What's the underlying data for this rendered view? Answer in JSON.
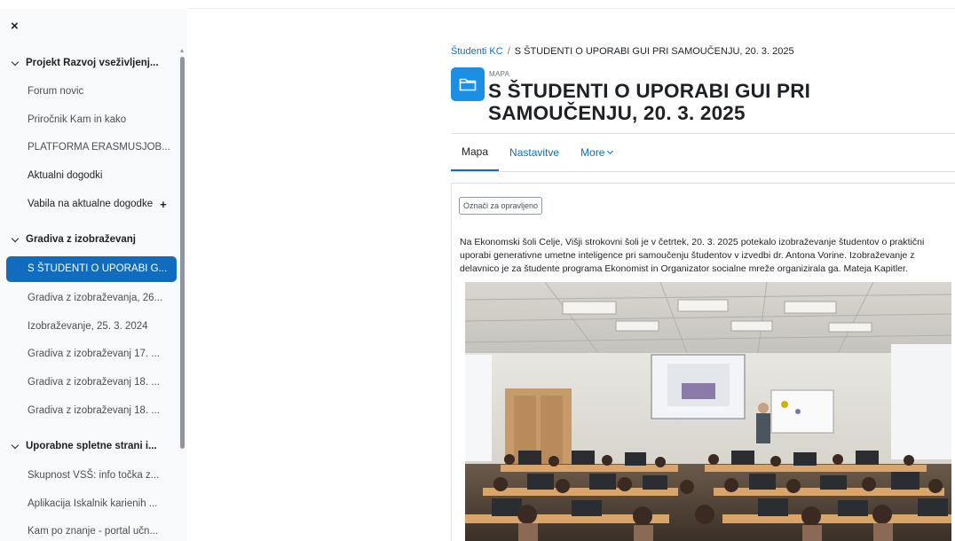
{
  "drawer": {
    "close_label": "×",
    "sections": [
      {
        "title": "Projekt Razvoj vseživljenj...",
        "items": [
          {
            "label": "Forum novic",
            "muted": true
          },
          {
            "label": "Priročnik Kam in kako",
            "muted": true
          },
          {
            "label": "PLATFORMA ERASMUSJOB...",
            "muted": true
          },
          {
            "label": "Aktualni dogodki",
            "muted": false
          },
          {
            "label": "Vabila na aktualne dogodke",
            "muted": false,
            "plus": "+"
          }
        ]
      },
      {
        "title": "Gradiva z izobraževanj",
        "items": [
          {
            "label": "S ŠTUDENTI O UPORABI G...",
            "active": true
          },
          {
            "label": "Gradiva z izobraževanja, 26...",
            "muted": true
          },
          {
            "label": "Izobraževanje, 25. 3. 2024",
            "muted": true
          },
          {
            "label": "Gradiva z izobraževanj 17. ...",
            "muted": true
          },
          {
            "label": "Gradiva z izobraževanj 18. ...",
            "muted": true
          },
          {
            "label": "Gradiva z izobraževanj 18. ...",
            "muted": true
          }
        ]
      },
      {
        "title": "Uporabne spletne strani i...",
        "items": [
          {
            "label": "Skupnost VSŠ: info točka z...",
            "muted": true
          },
          {
            "label": "Aplikacija Iskalnik karienih ...",
            "muted": true
          },
          {
            "label": "Kam po znanje - portal učn...",
            "muted": true
          }
        ]
      }
    ]
  },
  "breadcrumb": {
    "link": "Študenti KC",
    "separator": "/",
    "current": "S ŠTUDENTI O UPORABI GUI PRI SAMOUČENJU, 20. 3. 2025"
  },
  "header": {
    "module_type": "MAPA",
    "title": "S ŠTUDENTI O UPORABI GUI PRI SAMOUČENJU, 20. 3. 2025",
    "icon": "folder-icon"
  },
  "tabs": [
    {
      "label": "Mapa",
      "active": true
    },
    {
      "label": "Nastavitve",
      "active": false
    },
    {
      "label": "More",
      "active": false,
      "dropdown": true
    }
  ],
  "content": {
    "mark_done_label": "Označi za opravljeno",
    "intro": "Na Ekonomski šoli Celje, Višji strokovni šoli je v četrtek, 20. 3. 2025 potekalo izobraževanje študentov o praktični uporabi generativne umetne inteligence pri samoučenju študentov v izvedbi dr. Antona Vorine. Izobraževanje z delavnico je za študente programa Ekonomist in Organizator socialne mreže organizirala ga. Mateja Kapitler."
  },
  "colors": {
    "accent": "#0f6cbf",
    "folder_icon_bg": "#1a8fe3",
    "drawer_bg": "#f8f9fa"
  }
}
